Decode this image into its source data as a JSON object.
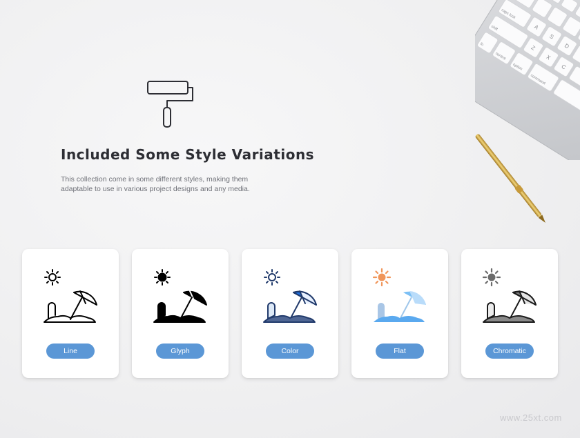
{
  "header": {
    "title": "Included Some Style Variations",
    "description": "This collection come in some different styles, making them adaptable to use in various project designs and any media.",
    "icon": "paint-roller-icon"
  },
  "keyboard": {
    "keys": [
      "caps lock",
      "shift",
      "fn",
      "control",
      "option",
      "command",
      "A",
      "S",
      "D",
      "Z",
      "X",
      "C"
    ]
  },
  "styles": [
    {
      "label": "Line",
      "icon": "beach-umbrella-line-icon"
    },
    {
      "label": "Glyph",
      "icon": "beach-umbrella-glyph-icon"
    },
    {
      "label": "Color",
      "icon": "beach-umbrella-color-icon"
    },
    {
      "label": "Flat",
      "icon": "beach-umbrella-flat-icon"
    },
    {
      "label": "Chromatic",
      "icon": "beach-umbrella-chromatic-icon"
    }
  ],
  "watermark": "www.25xt.com",
  "colors": {
    "pill": "#5b97d6",
    "text_dark": "#2d2e34",
    "text_muted": "#6f7178",
    "color_navy": "#213a6b",
    "color_blue": "#1d6fe0",
    "flat_orange": "#f0965b",
    "flat_blue": "#7cc0f5",
    "chromatic_gray": "#7a7a7a"
  }
}
